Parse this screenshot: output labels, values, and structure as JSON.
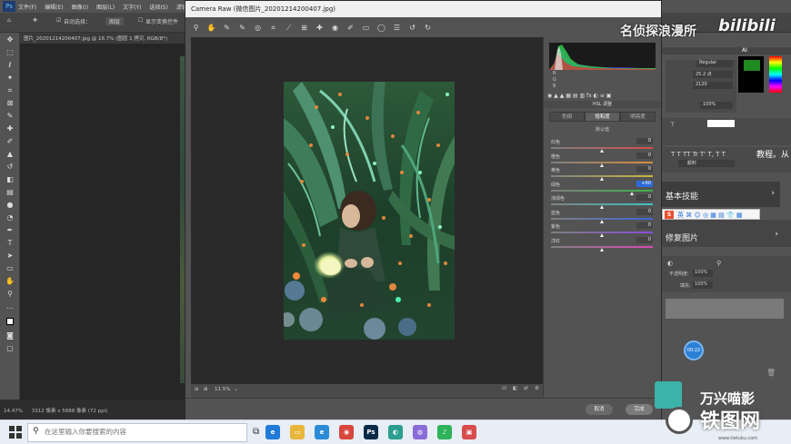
{
  "ps": {
    "menus": [
      "文件(F)",
      "编辑(E)",
      "图像(I)",
      "图层(L)",
      "文字(Y)",
      "选择(S)",
      "滤镜"
    ],
    "options": {
      "auto_select": "自动选择：",
      "layer": "图层",
      "show_transform": "显示变换控件"
    },
    "tab_title": "图片_20201214200407.jpg @ 16.7% (图层 1 拷贝, RGB/8*)",
    "status": {
      "zoom": "14.47%",
      "doc_size": "3312 像素 x 5888 像素 (72 ppi)"
    },
    "tools": [
      "move-icon",
      "marquee-icon",
      "lasso-icon",
      "magic-wand-icon",
      "crop-icon",
      "frame-icon",
      "eyedropper-icon",
      "healing-icon",
      "brush-icon",
      "stamp-icon",
      "history-brush-icon",
      "eraser-icon",
      "gradient-icon",
      "blur-icon",
      "dodge-icon",
      "pen-icon",
      "type-icon",
      "path-select-icon",
      "shape-icon",
      "hand-icon",
      "zoom-icon",
      "more-icon"
    ]
  },
  "cr": {
    "title": "Camera Raw (微信图片_20201214200407.jpg)",
    "panel_title": "HSL 调整",
    "tabs": [
      "色相",
      "饱和度",
      "明亮度"
    ],
    "default_label": "默认值",
    "sliders": [
      {
        "label": "红色",
        "value": "0",
        "pos": 0.5,
        "from": "#d84c4c",
        "to": "#d84c4c"
      },
      {
        "label": "橙色",
        "value": "0",
        "pos": 0.5,
        "from": "#d98b3c",
        "to": "#d98b3c"
      },
      {
        "label": "黄色",
        "value": "0",
        "pos": 0.5,
        "from": "#c9b83c",
        "to": "#c9b83c"
      },
      {
        "label": "绿色",
        "value": "+60",
        "pos": 0.8,
        "from": "#3cb34a",
        "to": "#3cb34a",
        "focus": true
      },
      {
        "label": "浅绿色",
        "value": "0",
        "pos": 0.5,
        "from": "#3cc3c3",
        "to": "#3cc3c3"
      },
      {
        "label": "蓝色",
        "value": "0",
        "pos": 0.5,
        "from": "#3c66d8",
        "to": "#3c66d8"
      },
      {
        "label": "紫色",
        "value": "0",
        "pos": 0.5,
        "from": "#8a4cd8",
        "to": "#8a4cd8"
      },
      {
        "label": "洋红",
        "value": "0",
        "pos": 0.5,
        "from": "#d84cb4",
        "to": "#d84cb4"
      }
    ],
    "zoom_value": "11.5%",
    "cancel": "取消",
    "done": "完成"
  },
  "right_panel": {
    "font_style": "Regular",
    "font_size": "25.2 点",
    "tracking": "2120",
    "scale": "100%",
    "tutorial_text": "教程。从",
    "link_text": "颜料",
    "basic_skills": "基本技能",
    "retouch": "修复图片",
    "opacity_label": "不透明度:",
    "opacity_value": "100%",
    "fill_label": "填充:",
    "fill_value": "100%",
    "timer": "00:22",
    "ai_label": "AI"
  },
  "overlay": {
    "channel": "名侦探浪漫所",
    "bilibili": "bilibili",
    "filmora": "万兴喵影",
    "watermark": "铁图网",
    "watermark_url": "www.tietuku.com"
  },
  "taskbar": {
    "search_placeholder": "在这里输入你要搜索的内容",
    "apps": [
      {
        "name": "edge-icon",
        "label": "e",
        "color": "#1f7ad8"
      },
      {
        "name": "folder-icon",
        "label": "▭",
        "color": "#e8b63c"
      },
      {
        "name": "ie-icon",
        "label": "e",
        "color": "#2b8bd6"
      },
      {
        "name": "chrome-icon",
        "label": "◉",
        "color": "#d8463c"
      },
      {
        "name": "photoshop-icon",
        "label": "Ps",
        "color": "#0b2a47"
      },
      {
        "name": "browser-icon",
        "label": "◐",
        "color": "#2b9e8f"
      },
      {
        "name": "360-icon",
        "label": "◍",
        "color": "#8a6cd8"
      },
      {
        "name": "qq-music-icon",
        "label": "♪",
        "color": "#2db35a"
      },
      {
        "name": "app-icon",
        "label": "▣",
        "color": "#d84c4c"
      }
    ]
  }
}
